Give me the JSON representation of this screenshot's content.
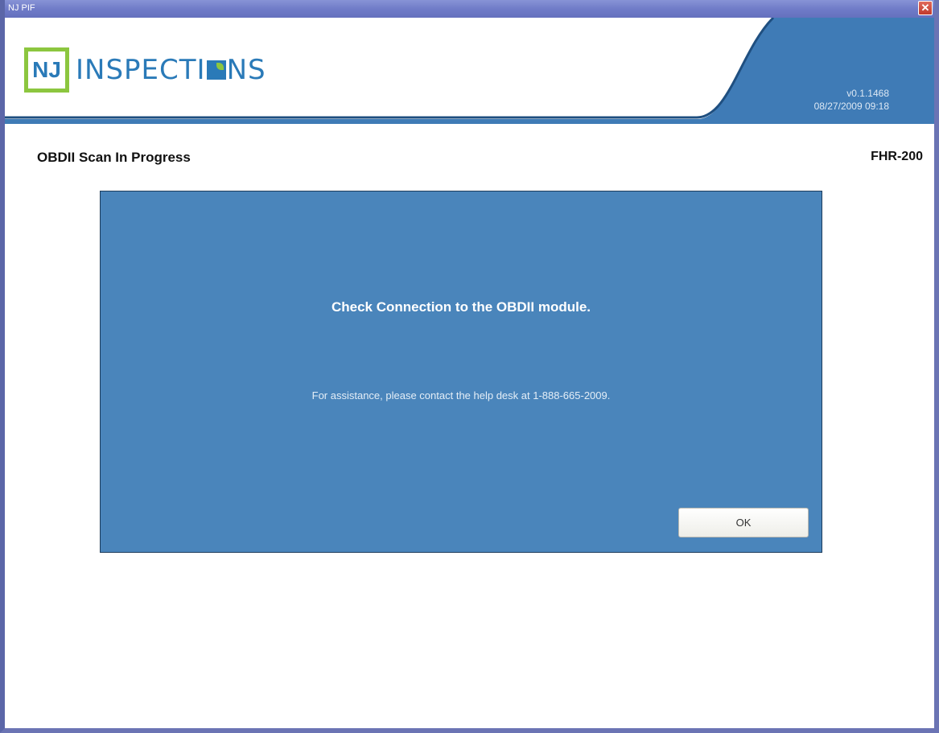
{
  "window": {
    "title": "NJ PIF",
    "close_label": "✕"
  },
  "header": {
    "logo_short": "NJ",
    "logo_word_1": "INSPECTI",
    "logo_word_2": "NS",
    "version": "v0.1.1468",
    "datetime": "08/27/2009 09:18"
  },
  "page": {
    "title": "OBDII Scan In Progress",
    "code": "FHR-200"
  },
  "dialog": {
    "message": "Check Connection to the OBDII module.",
    "help_text": "For assistance, please contact the help desk at 1-888-665-2009.",
    "ok_label": "OK"
  },
  "colors": {
    "title_bar": "#6f7bc6",
    "header_blue": "#3f7bb6",
    "dialog_blue": "#4a85bb",
    "logo_green": "#8cc63f",
    "logo_blue": "#2a7ab8"
  }
}
